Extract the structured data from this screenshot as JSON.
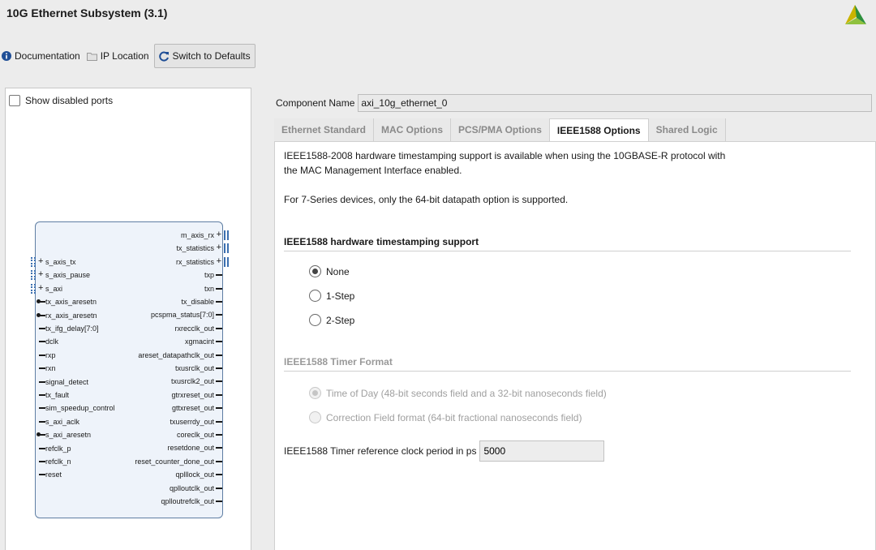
{
  "window": {
    "title": "10G Ethernet Subsystem (3.1)"
  },
  "toolbar": {
    "documentation": "Documentation",
    "ip_location": "IP Location",
    "switch_defaults": "Switch to Defaults"
  },
  "left": {
    "show_disabled_ports": "Show disabled ports",
    "left_ports": [
      "s_axis_tx",
      "s_axis_pause",
      "s_axi",
      "tx_axis_aresetn",
      "rx_axis_aresetn",
      "tx_ifg_delay[7:0]",
      "dclk",
      "rxp",
      "rxn",
      "signal_detect",
      "tx_fault",
      "sim_speedup_control",
      "s_axi_aclk",
      "s_axi_aresetn",
      "refclk_p",
      "refclk_n",
      "reset"
    ],
    "right_ports": [
      "m_axis_rx",
      "tx_statistics",
      "rx_statistics",
      "txp",
      "txn",
      "tx_disable",
      "pcspma_status[7:0]",
      "rxrecclk_out",
      "xgmacint",
      "areset_datapathclk_out",
      "txusrclk_out",
      "txusrclk2_out",
      "gtrxreset_out",
      "gttxreset_out",
      "txuserrdy_out",
      "coreclk_out",
      "resetdone_out",
      "reset_counter_done_out",
      "qplllock_out",
      "qplloutclk_out",
      "qplloutrefclk_out"
    ]
  },
  "component": {
    "label": "Component Name",
    "value": "axi_10g_ethernet_0"
  },
  "tabs": [
    "Ethernet Standard",
    "MAC Options",
    "PCS/PMA Options",
    "IEEE1588 Options",
    "Shared Logic"
  ],
  "active_tab": "IEEE1588 Options",
  "ieee": {
    "info1_line1": "IEEE1588-2008 hardware timestamping support is available when using the 10GBASE-R protocol with",
    "info1_line2": "the MAC Management Interface enabled.",
    "info2": "For 7-Series devices, only the 64-bit datapath option is supported.",
    "ts_section": "IEEE1588 hardware timestamping support",
    "ts_options": [
      "None",
      "1-Step",
      "2-Step"
    ],
    "ts_selected": "None",
    "timer_section": "IEEE1588 Timer Format",
    "timer_options": [
      "Time of Day (48-bit seconds field and a 32-bit nanoseconds field)",
      "Correction Field format (64-bit fractional nanoseconds field)"
    ],
    "timer_selected": "Time of Day (48-bit seconds field and a 32-bit nanoseconds field)",
    "period_label": "IEEE1588 Timer reference clock period in ps",
    "period_value": "5000"
  },
  "colors": {
    "accent": "#3b6fb0",
    "block_fill": "#eef3fa",
    "block_border": "#5f7ea3"
  }
}
